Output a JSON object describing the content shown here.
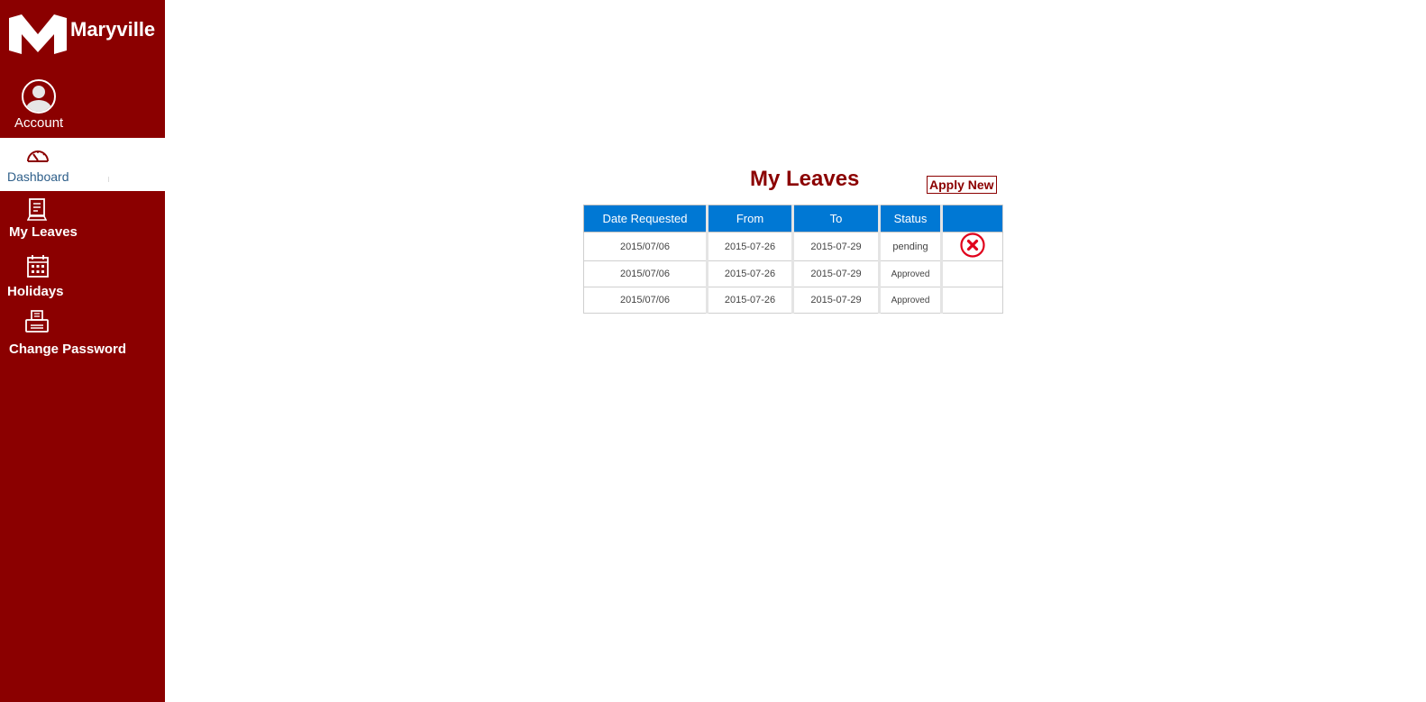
{
  "app": {
    "brand": "Maryville"
  },
  "sidebar": {
    "account_label": "Account",
    "items": [
      {
        "id": "dashboard",
        "label": "Dashboard",
        "icon": "gauge-icon",
        "active": true
      },
      {
        "id": "my-leaves",
        "label": "My Leaves",
        "icon": "document-icon",
        "active": false
      },
      {
        "id": "holidays",
        "label": "Holidays",
        "icon": "calendar-icon",
        "active": false
      },
      {
        "id": "change-password",
        "label": "Change Password",
        "icon": "printer-icon",
        "active": false
      }
    ]
  },
  "main": {
    "title": "My Leaves",
    "apply_button": "Apply New",
    "table": {
      "headers": [
        "Date Requested",
        "From",
        "To",
        "Status",
        ""
      ],
      "rows": [
        {
          "requested": "2015/07/06",
          "from": "2015-07-26",
          "to": "2015-07-29",
          "status": "pending",
          "cancel_icon": "cancel-circle-icon"
        },
        {
          "requested": "2015/07/06",
          "from": "2015-07-26",
          "to": "2015-07-29",
          "status": "Approved"
        },
        {
          "requested": "2015/07/06",
          "from": "2015-07-26",
          "to": "2015-07-29",
          "status": "Approved"
        }
      ]
    }
  },
  "colors": {
    "sidebar": "#8b0000",
    "accent": "#8b0000",
    "table_header": "#0078d4",
    "cancel": "#e0001b"
  }
}
